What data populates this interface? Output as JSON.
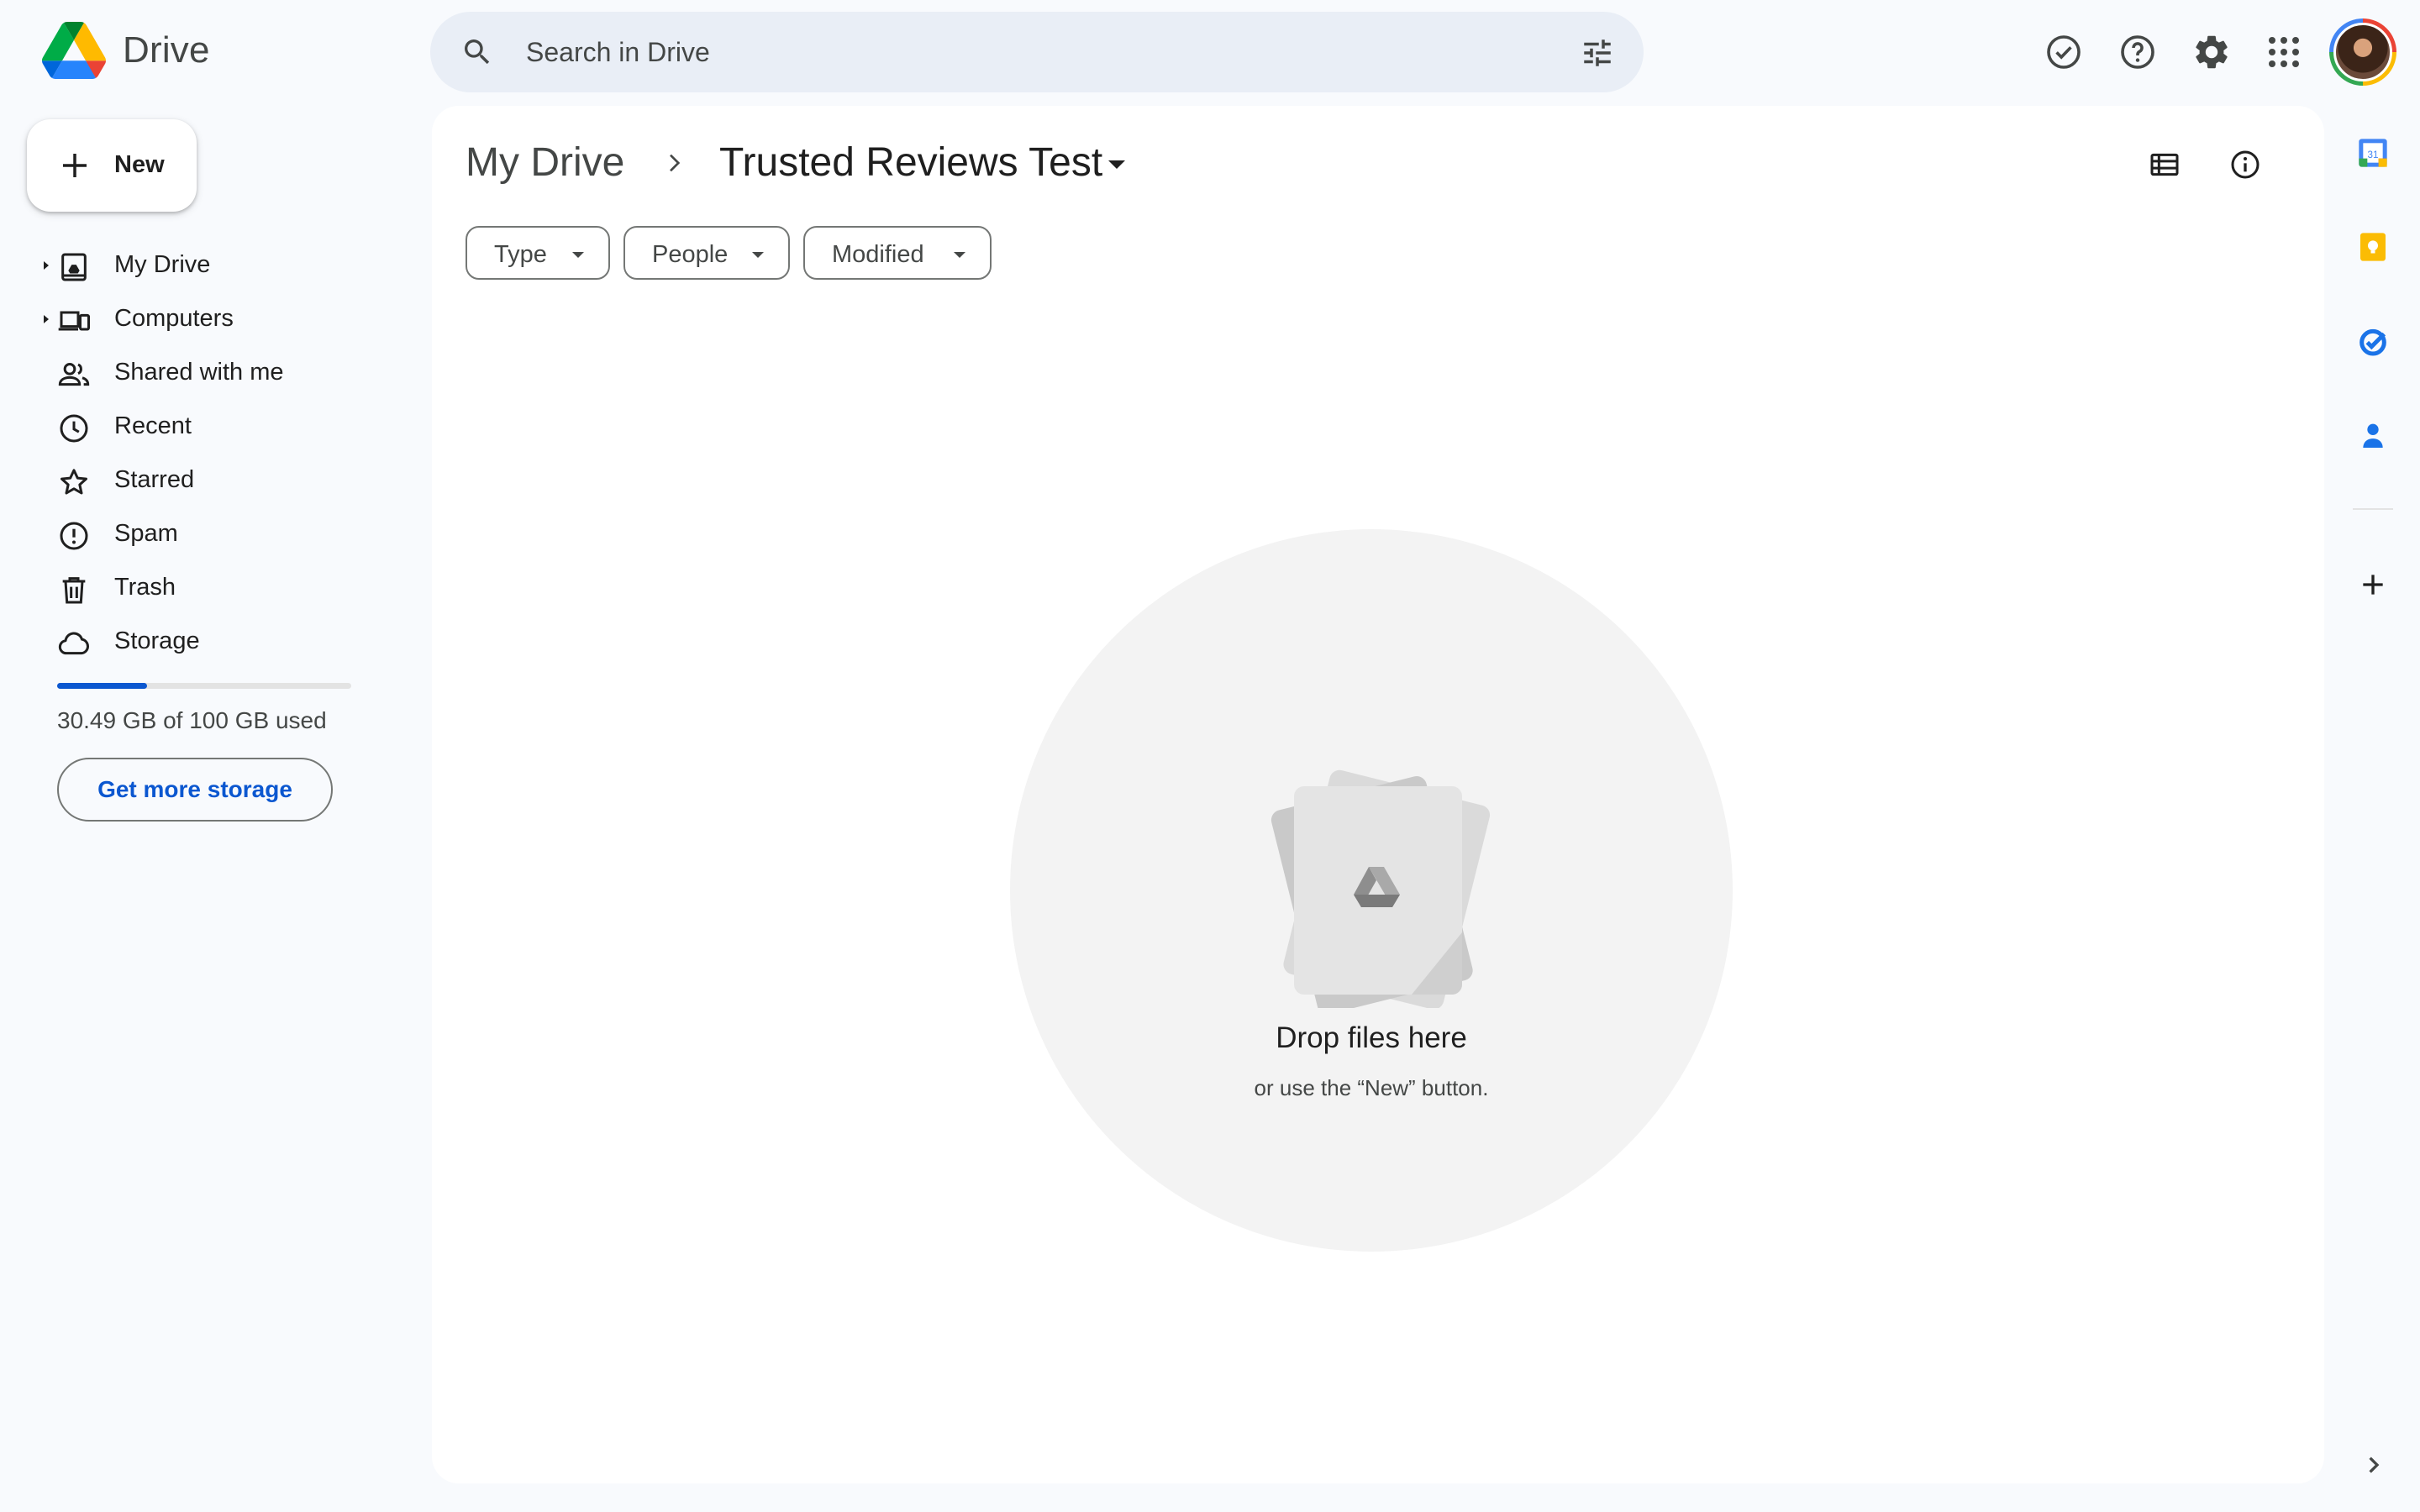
{
  "app": {
    "name": "Drive",
    "logo_icon": "google-drive-logo"
  },
  "search": {
    "placeholder": "Search in Drive",
    "icon": "search-icon",
    "filter_icon": "tune-icon"
  },
  "header_icons": [
    "ready-for-offline-icon",
    "help-icon",
    "settings-icon",
    "apps-grid-icon",
    "account-avatar"
  ],
  "new_button": {
    "label": "New",
    "icon": "plus-icon"
  },
  "sidebar": {
    "items": [
      {
        "label": "My Drive",
        "icon": "my-drive-icon",
        "expandable": true
      },
      {
        "label": "Computers",
        "icon": "computers-icon",
        "expandable": true
      },
      {
        "label": "Shared with me",
        "icon": "shared-people-icon",
        "expandable": false
      },
      {
        "label": "Recent",
        "icon": "clock-icon",
        "expandable": false
      },
      {
        "label": "Starred",
        "icon": "star-icon",
        "expandable": false
      },
      {
        "label": "Spam",
        "icon": "spam-icon",
        "expandable": false
      },
      {
        "label": "Trash",
        "icon": "trash-icon",
        "expandable": false
      },
      {
        "label": "Storage",
        "icon": "cloud-icon",
        "expandable": false
      }
    ]
  },
  "storage": {
    "used_fraction": 0.3049,
    "text": "30.49 GB of 100 GB used",
    "button_label": "Get more storage"
  },
  "breadcrumb": {
    "root": "My Drive",
    "separator_icon": "chevron-right-icon",
    "current": "Trusted Reviews Test",
    "dropdown_icon": "arrow-drop-down-icon"
  },
  "view_controls": [
    "list-view-icon",
    "info-icon"
  ],
  "filters": [
    {
      "label": "Type"
    },
    {
      "label": "People"
    },
    {
      "label": "Modified"
    }
  ],
  "empty_state": {
    "title": "Drop files here",
    "subtitle": "or use the “New” button."
  },
  "right_rail": [
    "calendar-icon",
    "keep-icon",
    "tasks-icon",
    "contacts-icon",
    "add-addon-icon",
    "expand-panel-icon"
  ],
  "colors": {
    "page_bg": "#f8fafd",
    "accent": "#0b57d0",
    "search_bg": "#e9eef6"
  }
}
